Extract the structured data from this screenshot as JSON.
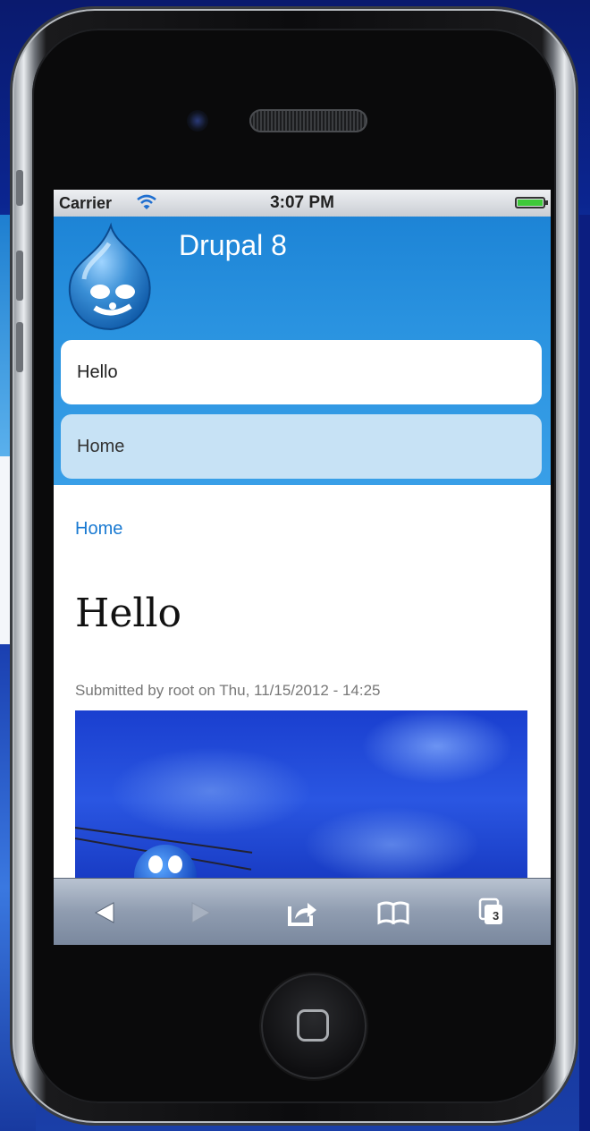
{
  "status_bar": {
    "carrier": "Carrier",
    "time": "3:07 PM",
    "wifi_icon": "wifi-icon",
    "battery_icon": "battery-icon"
  },
  "site": {
    "name": "Drupal 8",
    "logo": "drupal-drop-logo"
  },
  "nav": {
    "items": [
      {
        "label": "Hello"
      },
      {
        "label": "Home"
      }
    ]
  },
  "content": {
    "breadcrumb": "Home",
    "title": "Hello",
    "submitted": "Submitted by root on Thu, 11/15/2012 - 14:25",
    "image": "sky-clouds-photo"
  },
  "toolbar": {
    "back_icon": "back-arrow-icon",
    "forward_icon": "forward-arrow-icon",
    "share_icon": "share-icon",
    "bookmarks_icon": "bookmarks-icon",
    "tabs_icon": "tabs-icon",
    "tabs_count": "3"
  },
  "colors": {
    "header_blue": "#2a93e0",
    "link_blue": "#1a7ad2",
    "nav_active_bg": "#c7e2f5",
    "battery_green": "#3ec93a"
  }
}
